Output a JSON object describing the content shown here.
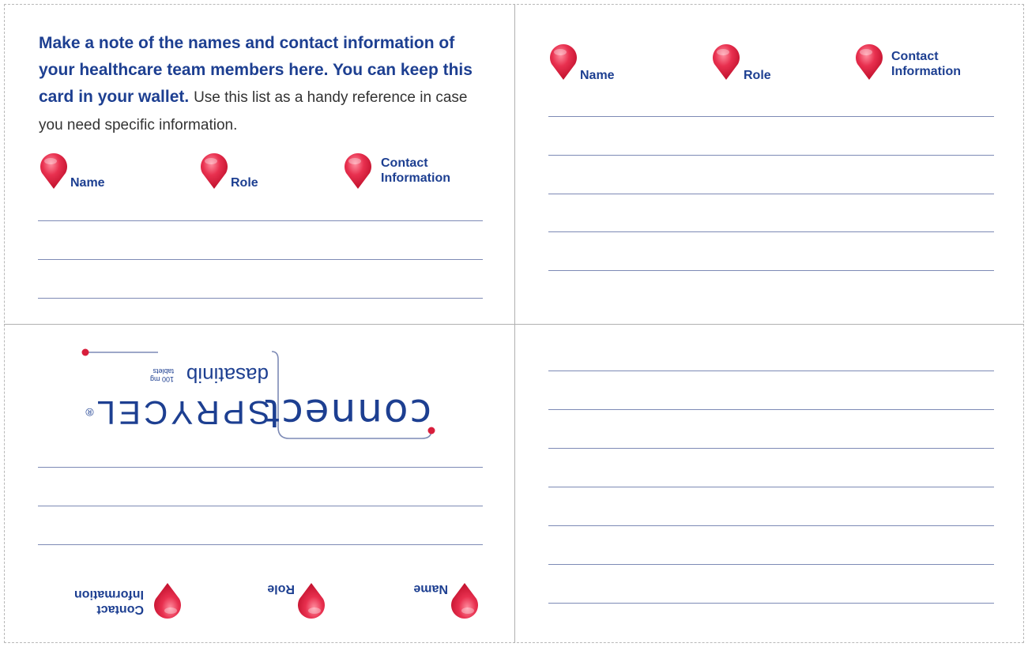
{
  "intro": {
    "bold_text": "Make a note of the names and contact information of your healthcare team members here. You can keep this card in your wallet.",
    "normal_text": "Use this list as a handy reference in case you need specific information."
  },
  "columns": {
    "name": "Name",
    "role": "Role",
    "contact_line1": "Contact",
    "contact_line2": "Information"
  },
  "logo": {
    "brand": "SPRYCEL",
    "registered": "®",
    "connect": "connect",
    "generic": "dasatinib",
    "dose_line1": "100 mg",
    "dose_line2": "tablets"
  },
  "colors": {
    "text_blue": "#1d3f91",
    "pin_red": "#d81e3c",
    "rule_line": "#7d8ab5"
  }
}
